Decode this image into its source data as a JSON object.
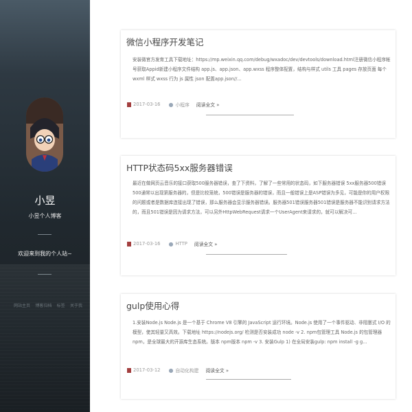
{
  "sidebar": {
    "site_name": "小昱",
    "site_desc": "小昱个人博客",
    "welcome": "欢迎来到我的个人站~",
    "nav": [
      "网站主页",
      "博客归档",
      "标签",
      "关于我"
    ]
  },
  "posts": [
    {
      "title": "微信小程序开发笔记",
      "excerpt": "安装微官方发育工具下载地址：https://mp.weixin.qq.com/debug/wxadoc/dev/devtools/download.html注册微信小程序帐号获取Appid新建小程序文件结构 app.js、app.json、app.wxss 程序整体配置，结构与样式 utils 工具 pages 存放页面 每个 wxml 样式 wxss 行为 js 属性 json 配置app.json//...",
      "date": "2017-03-16",
      "tag": "小程序",
      "more": "阅读全文 »"
    },
    {
      "title": "HTTP状态码5xx服务器错误",
      "excerpt": "最近在做网页云音乐的接口获取500服务器错误，查了下资料，了解了一些常用的状态码，如下服务器错误 5xx服务器500错误500通常以出现第服务器的，但是比较笼统，500错误是服务器的错误，而且一般错误上是ASP错误为多见，可能是你的用户权限的问题或者是数据库连接出现了错误，那么服务器会显示服务器错误。服务器501错误服务器501错误是服务器不能识别请求方法的，而且501错误是因为请求方法，可以另外HttpWebRequest请求一个UserAgent来请求的，就可以解决可...",
      "date": "2017-03-16",
      "tag": "HTTP",
      "more": "阅读全文 »"
    },
    {
      "title": "gulp使用心得",
      "excerpt": "1.安装Node.js Node.js 是一个基于 Chrome V8 引擎的 JavaScript 运行环境。Node.js 使用了一个事件驱动、非阻塞式 I/O 的模型，使其轻量又高效。下载地址 https://nodejs.org/ 检测是否安装成功 node -v 2. npm包管理工具 Node.js 的包管理器 npm，是全球最大的开源库生态系统。版本 npm版本 npm -v 3. 安装Gulp 1) 在全局安装gulp: npm install -g g...",
      "date": "2017-03-12",
      "tag": "自动化构建",
      "more": "阅读全文 »"
    }
  ]
}
